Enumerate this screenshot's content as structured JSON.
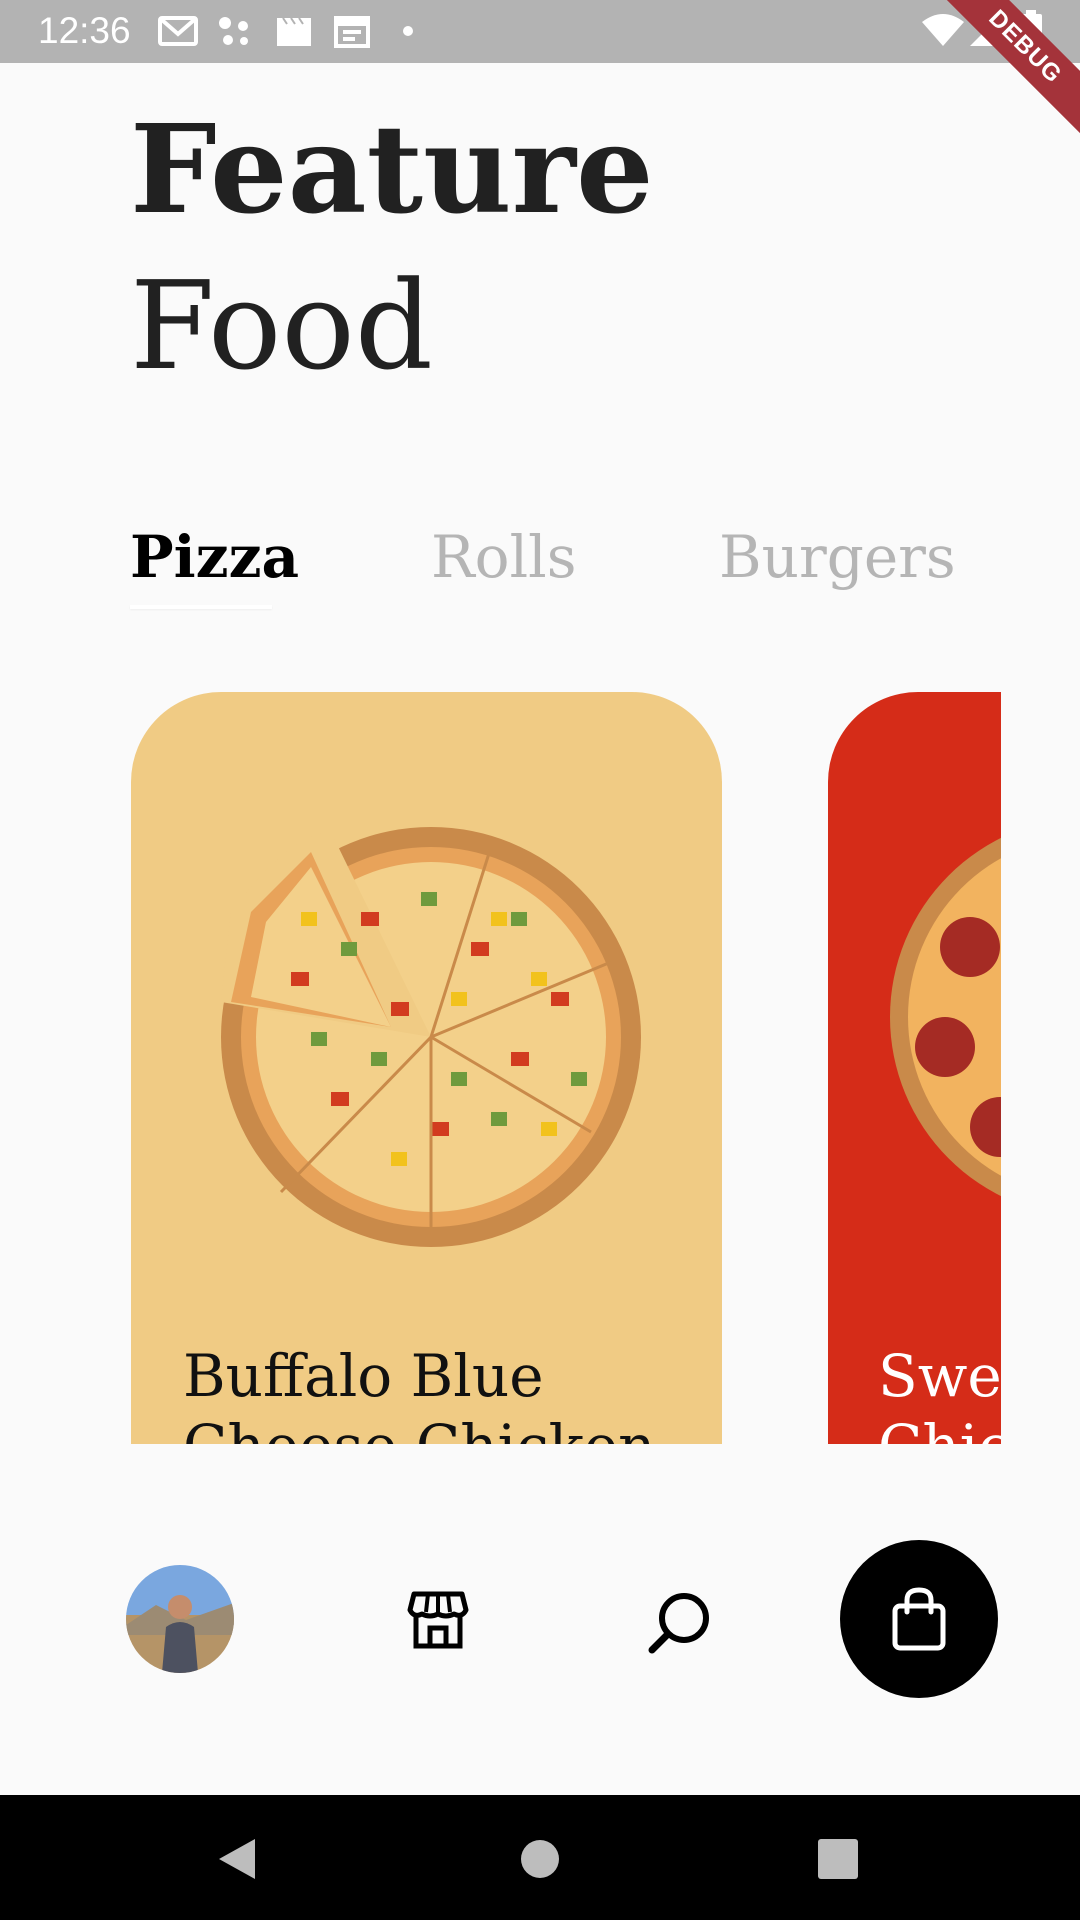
{
  "status_bar": {
    "time": "12:36",
    "icons": [
      "gmail-icon",
      "assistant-dots-icon",
      "clapper-icon",
      "calendar-icon",
      "dot-icon",
      "wifi-icon",
      "signal-icon",
      "battery-icon"
    ],
    "debug_label": "DEBUG"
  },
  "header": {
    "title_bold": "Feature",
    "title_light": "Food"
  },
  "tabs": [
    {
      "label": "Pizza",
      "active": true
    },
    {
      "label": "Rolls",
      "active": false
    },
    {
      "label": "Burgers",
      "active": false
    }
  ],
  "cards": [
    {
      "name": "Buffalo Blue Cheese Chicken",
      "color": "#f0cb84",
      "icon": "pizza-image"
    },
    {
      "name": "Sweet Chili Chicken",
      "color": "#d52c18",
      "icon": "pepperoni-pizza-image"
    }
  ],
  "bottom_nav": {
    "icons": [
      "avatar",
      "store-icon",
      "search-icon",
      "shopping-bag-icon"
    ]
  },
  "colors": {
    "background": "#fafafa",
    "status_bar": "#b3b3b3",
    "card_yellow": "#f0cb84",
    "card_red": "#d52c18",
    "text_primary": "#212121",
    "tab_inactive": "#b5b5b5",
    "accent_black": "#000000"
  },
  "system_nav": {
    "icons": [
      "back-icon",
      "home-icon",
      "recents-icon"
    ]
  }
}
